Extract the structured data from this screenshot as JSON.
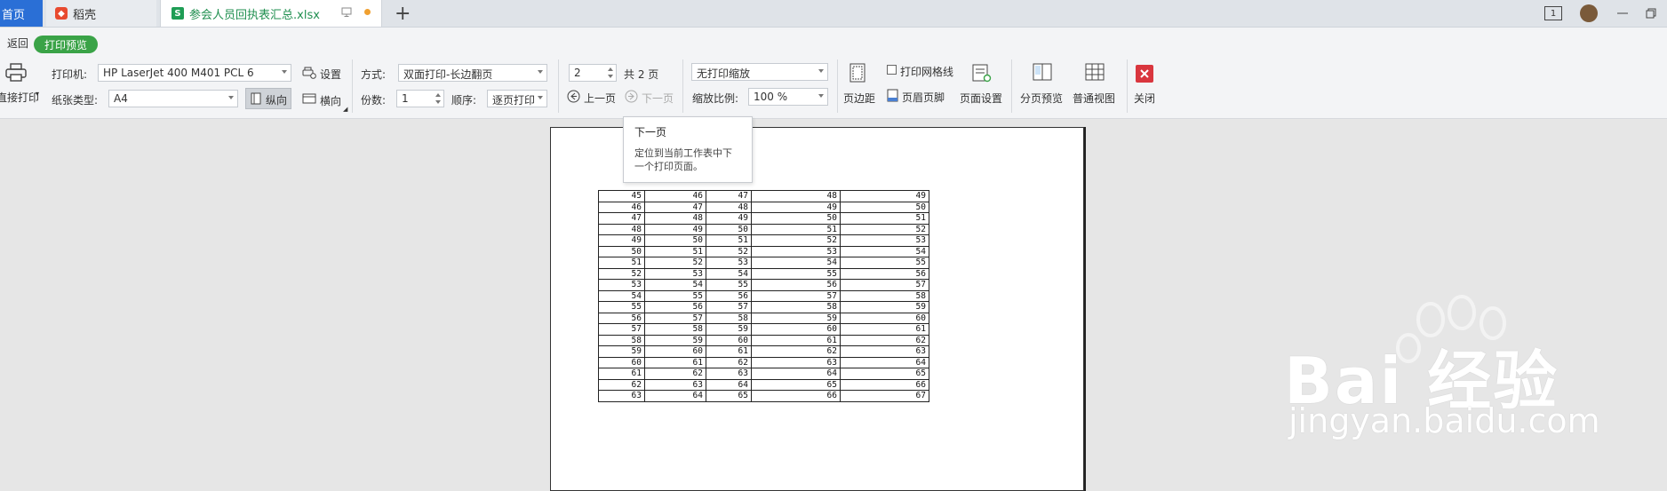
{
  "tabs": {
    "home": "首页",
    "docer": "稻壳",
    "file": "参会人员回执表汇总.xlsx"
  },
  "window": {
    "window_count": "1"
  },
  "subbar": {
    "back": "返回",
    "print_preview": "打印预览"
  },
  "toolbar": {
    "direct_print": "直接打印",
    "printer_label": "打印机:",
    "printer_value": "HP LaserJet 400 M401 PCL 6",
    "settings": "设置",
    "paper_label": "纸张类型:",
    "paper_value": "A4",
    "portrait": "纵向",
    "landscape": "横向",
    "mode_label": "方式:",
    "mode_value": "双面打印-长边翻页",
    "copies_label": "份数:",
    "copies_value": "1",
    "order_label": "顺序:",
    "order_value": "逐页打印",
    "page_value": "2",
    "page_total": "共 2 页",
    "prev_page": "上一页",
    "next_page": "下一页",
    "scale_mode": "无打印缩放",
    "scale_label": "缩放比例:",
    "scale_value": "100 %",
    "margins": "页边距",
    "gridlines": "打印网格线",
    "header_footer": "页眉页脚",
    "page_setup": "页面设置",
    "page_break_preview": "分页预览",
    "normal_view": "普通视图",
    "close": "关闭"
  },
  "tooltip": {
    "title": "下一页",
    "body": "定位到当前工作表中下一个打印页面。"
  },
  "sheet_rows": [
    [
      "45",
      "46",
      "47",
      "48",
      "49"
    ],
    [
      "46",
      "47",
      "48",
      "49",
      "50"
    ],
    [
      "47",
      "48",
      "49",
      "50",
      "51"
    ],
    [
      "48",
      "49",
      "50",
      "51",
      "52"
    ],
    [
      "49",
      "50",
      "51",
      "52",
      "53"
    ],
    [
      "50",
      "51",
      "52",
      "53",
      "54"
    ],
    [
      "51",
      "52",
      "53",
      "54",
      "55"
    ],
    [
      "52",
      "53",
      "54",
      "55",
      "56"
    ],
    [
      "53",
      "54",
      "55",
      "56",
      "57"
    ],
    [
      "54",
      "55",
      "56",
      "57",
      "58"
    ],
    [
      "55",
      "56",
      "57",
      "58",
      "59"
    ],
    [
      "56",
      "57",
      "58",
      "59",
      "60"
    ],
    [
      "57",
      "58",
      "59",
      "60",
      "61"
    ],
    [
      "58",
      "59",
      "60",
      "61",
      "62"
    ],
    [
      "59",
      "60",
      "61",
      "62",
      "63"
    ],
    [
      "60",
      "61",
      "62",
      "63",
      "64"
    ],
    [
      "61",
      "62",
      "63",
      "64",
      "65"
    ],
    [
      "62",
      "63",
      "64",
      "65",
      "66"
    ],
    [
      "63",
      "64",
      "65",
      "66",
      "67"
    ]
  ],
  "watermark": {
    "line1": "Bai 经验",
    "line2": "jingyan.baidu.com"
  },
  "colors": {
    "accent_green": "#3aa347",
    "home_tab": "#2a6fd6",
    "close_red": "#d9363e"
  }
}
